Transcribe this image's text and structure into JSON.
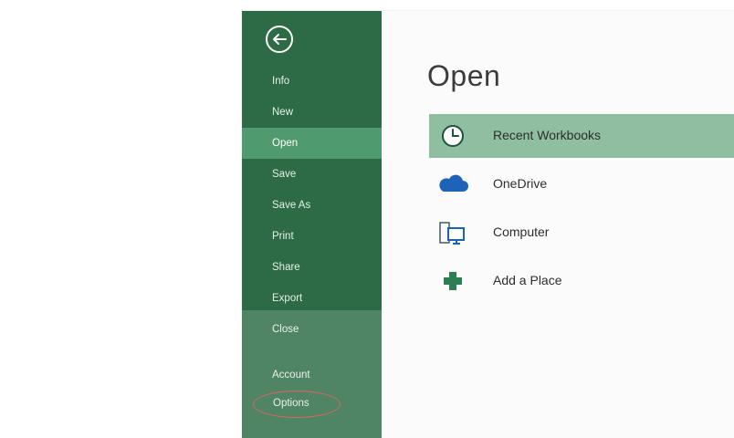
{
  "backstage": {
    "back_icon": "back-arrow-icon",
    "nav_items": [
      {
        "label": "Info",
        "active": false
      },
      {
        "label": "New",
        "active": false
      },
      {
        "label": "Open",
        "active": true
      },
      {
        "label": "Save",
        "active": false
      },
      {
        "label": "Save As",
        "active": false
      },
      {
        "label": "Print",
        "active": false
      },
      {
        "label": "Share",
        "active": false
      },
      {
        "label": "Export",
        "active": false
      },
      {
        "label": "Close",
        "active": false
      },
      {
        "label": "Account",
        "active": false
      },
      {
        "label": "Options",
        "active": false
      }
    ]
  },
  "main": {
    "title": "Open",
    "places": [
      {
        "label": "Recent Workbooks",
        "icon": "clock-icon",
        "selected": true
      },
      {
        "label": "OneDrive",
        "icon": "cloud-icon",
        "selected": false
      },
      {
        "label": "Computer",
        "icon": "computer-icon",
        "selected": false
      },
      {
        "label": "Add a Place",
        "icon": "plus-icon",
        "selected": false
      }
    ]
  },
  "colors": {
    "sidebar": "#2c6b45",
    "active": "#4f9a6e",
    "selected_place": "#8fbea0",
    "highlight_circle": "#d54545"
  }
}
